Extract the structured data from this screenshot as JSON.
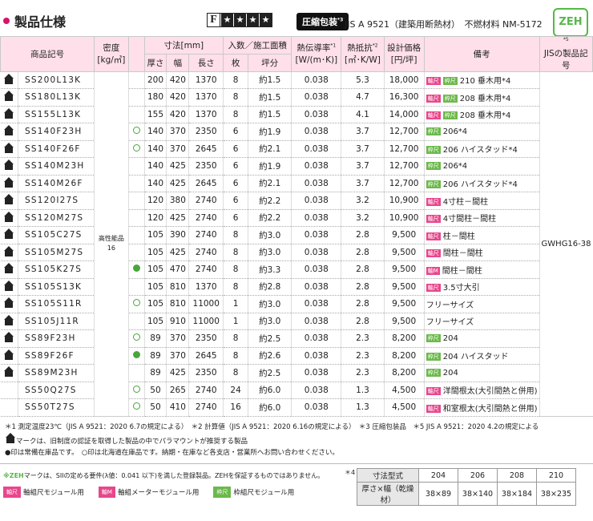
{
  "header": {
    "title": "製品仕様",
    "fire_rating": "F",
    "stars": [
      "★",
      "★",
      "★",
      "★"
    ],
    "compressed_label": "圧縮包装",
    "compressed_note": "*3",
    "jis_standard": "JIS A 9521（建築用断熱材）",
    "noncombustible": "不燃材料 NM-5172",
    "zeh_logo": "ZEH"
  },
  "table_headers": {
    "product_code": "商品記号",
    "density": "密度",
    "density_unit": "[kg/㎥]",
    "dimensions": "寸法",
    "dimensions_unit": "[mm]",
    "thickness": "厚さ",
    "width": "幅",
    "length": "長さ",
    "quantity": "入数／施工面積",
    "pieces": "枚",
    "tsubo": "坪分",
    "conductivity": "熱伝導率",
    "conductivity_note": "*1",
    "conductivity_unit": "[W/(m･K)]",
    "resistance": "熱抵抗",
    "resistance_note": "*2",
    "resistance_unit": "[㎡･K/W]",
    "price": "設計価格",
    "price_unit": "[円/坪]",
    "remarks": "備考",
    "jis_product": "JISの製品記号",
    "jis_note": "*5"
  },
  "density_value": "高性能品\n16",
  "jis_code": "GWHG16-38",
  "rows": [
    {
      "code": "SS200L13K",
      "mark": "",
      "t": "200",
      "w": "420",
      "l": "1370",
      "n": "8",
      "a": "約1.5",
      "k": "0.038",
      "r": "5.3",
      "p": "18,000",
      "tags": [
        "軸尺",
        "枠尺"
      ],
      "rem": "210 垂木用*4"
    },
    {
      "code": "SS180L13K",
      "mark": "",
      "t": "180",
      "w": "420",
      "l": "1370",
      "n": "8",
      "a": "約1.5",
      "k": "0.038",
      "r": "4.7",
      "p": "16,300",
      "tags": [
        "軸尺",
        "枠尺"
      ],
      "rem": "208 垂木用*4"
    },
    {
      "code": "SS155L13K",
      "mark": "",
      "t": "155",
      "w": "420",
      "l": "1370",
      "n": "8",
      "a": "約1.5",
      "k": "0.038",
      "r": "4.1",
      "p": "14,000",
      "tags": [
        "軸尺",
        "枠尺"
      ],
      "rem": "208 垂木用*4"
    },
    {
      "code": "SS140F23H",
      "mark": "ring",
      "t": "140",
      "w": "370",
      "l": "2350",
      "n": "6",
      "a": "約1.9",
      "k": "0.038",
      "r": "3.7",
      "p": "12,700",
      "tags": [
        "枠尺"
      ],
      "rem": "206*4"
    },
    {
      "code": "SS140F26F",
      "mark": "ring",
      "t": "140",
      "w": "370",
      "l": "2645",
      "n": "6",
      "a": "約2.1",
      "k": "0.038",
      "r": "3.7",
      "p": "12,700",
      "tags": [
        "枠尺"
      ],
      "rem": "206 ハイスタッド*4"
    },
    {
      "code": "SS140M23H",
      "mark": "",
      "t": "140",
      "w": "425",
      "l": "2350",
      "n": "6",
      "a": "約1.9",
      "k": "0.038",
      "r": "3.7",
      "p": "12,700",
      "tags": [
        "枠尺"
      ],
      "rem": "206*4"
    },
    {
      "code": "SS140M26F",
      "mark": "",
      "t": "140",
      "w": "425",
      "l": "2645",
      "n": "6",
      "a": "約2.1",
      "k": "0.038",
      "r": "3.7",
      "p": "12,700",
      "tags": [
        "枠尺"
      ],
      "rem": "206 ハイスタッド*4"
    },
    {
      "code": "SS120I27S",
      "mark": "",
      "t": "120",
      "w": "380",
      "l": "2740",
      "n": "6",
      "a": "約2.2",
      "k": "0.038",
      "r": "3.2",
      "p": "10,900",
      "tags": [
        "軸尺"
      ],
      "rem": "4寸柱－間柱"
    },
    {
      "code": "SS120M27S",
      "mark": "",
      "t": "120",
      "w": "425",
      "l": "2740",
      "n": "6",
      "a": "約2.2",
      "k": "0.038",
      "r": "3.2",
      "p": "10,900",
      "tags": [
        "軸尺"
      ],
      "rem": "4寸間柱－間柱"
    },
    {
      "code": "SS105C27S",
      "mark": "",
      "t": "105",
      "w": "390",
      "l": "2740",
      "n": "8",
      "a": "約3.0",
      "k": "0.038",
      "r": "2.8",
      "p": "9,500",
      "tags": [
        "軸尺"
      ],
      "rem": "柱－間柱"
    },
    {
      "code": "SS105M27S",
      "mark": "",
      "t": "105",
      "w": "425",
      "l": "2740",
      "n": "8",
      "a": "約3.0",
      "k": "0.038",
      "r": "2.8",
      "p": "9,500",
      "tags": [
        "軸尺"
      ],
      "rem": "間柱－間柱"
    },
    {
      "code": "SS105K27S",
      "mark": "fill",
      "t": "105",
      "w": "470",
      "l": "2740",
      "n": "8",
      "a": "約3.3",
      "k": "0.038",
      "r": "2.8",
      "p": "9,500",
      "tags": [
        "軸M"
      ],
      "rem": "間柱－間柱"
    },
    {
      "code": "SS105S13K",
      "mark": "",
      "t": "105",
      "w": "810",
      "l": "1370",
      "n": "8",
      "a": "約2.8",
      "k": "0.038",
      "r": "2.8",
      "p": "9,500",
      "tags": [
        "軸尺"
      ],
      "rem": "3.5寸大引"
    },
    {
      "code": "SS105S11R",
      "mark": "ring",
      "t": "105",
      "w": "810",
      "l": "11000",
      "n": "1",
      "a": "約3.0",
      "k": "0.038",
      "r": "2.8",
      "p": "9,500",
      "tags": [],
      "rem": "フリーサイズ"
    },
    {
      "code": "SS105J11R",
      "mark": "",
      "t": "105",
      "w": "910",
      "l": "11000",
      "n": "1",
      "a": "約3.0",
      "k": "0.038",
      "r": "2.8",
      "p": "9,500",
      "tags": [],
      "rem": "フリーサイズ"
    },
    {
      "code": "SS89F23H",
      "mark": "ring",
      "t": "89",
      "w": "370",
      "l": "2350",
      "n": "8",
      "a": "約2.5",
      "k": "0.038",
      "r": "2.3",
      "p": "8,200",
      "tags": [
        "枠尺"
      ],
      "rem": "204"
    },
    {
      "code": "SS89F26F",
      "mark": "fill",
      "t": "89",
      "w": "370",
      "l": "2645",
      "n": "8",
      "a": "約2.6",
      "k": "0.038",
      "r": "2.3",
      "p": "8,200",
      "tags": [
        "枠尺"
      ],
      "rem": "204 ハイスタッド"
    },
    {
      "code": "SS89M23H",
      "mark": "",
      "t": "89",
      "w": "425",
      "l": "2350",
      "n": "8",
      "a": "約2.5",
      "k": "0.038",
      "r": "2.3",
      "p": "8,200",
      "tags": [
        "枠尺"
      ],
      "rem": "204"
    },
    {
      "code": "SS50Q27S",
      "mark": "ring",
      "t": "50",
      "w": "265",
      "l": "2740",
      "n": "24",
      "a": "約6.0",
      "k": "0.038",
      "r": "1.3",
      "p": "4,500",
      "tags": [
        "軸尺"
      ],
      "rem": "洋間根太(大引間熱と併用)"
    },
    {
      "code": "SS50T27S",
      "mark": "ring",
      "t": "50",
      "w": "410",
      "l": "2740",
      "n": "16",
      "a": "約6.0",
      "k": "0.038",
      "r": "1.3",
      "p": "4,500",
      "tags": [
        "軸尺"
      ],
      "rem": "和室根太(大引間熱と併用)"
    }
  ],
  "icon_rows": [
    0,
    1,
    2,
    3,
    4,
    5,
    6,
    7,
    8,
    9,
    10,
    11,
    12,
    13,
    14,
    15,
    16,
    17
  ],
  "notes": [
    "＊1 測定温度23℃（JIS A 9521：2020 6.7の規定による）　＊2 計算値（JIS A 9521：2020 6.16の規定による）　＊3 圧縮包装品　＊5 JIS A 9521：2020 4.2の規定による",
    "マークは、旧制度の認証を取得した製品の中でパラマウントが推奨する製品",
    "●印は常備在庫品です。　○印は北海道在庫品です。納期・在庫など各支店・営業所へお問い合わせください。"
  ],
  "zeh_note_prefix": "※ZEH",
  "zeh_note": "マークは、SIIの定める要件(λ値：0.041 以下)を満した登録製品。ZEHを保証するものではありません。",
  "legend": [
    {
      "tag": "軸尺",
      "text": "軸組尺モジュール用"
    },
    {
      "tag": "軸M",
      "text": "軸組メーターモジュール用"
    },
    {
      "tag": "枠尺",
      "text": "枠組尺モジュール用"
    }
  ],
  "std_note": "＊4",
  "std_table": {
    "row1_label": "寸法型式",
    "row1": [
      "204",
      "206",
      "208",
      "210"
    ],
    "row2_label": "厚さ×幅（乾燥材）",
    "row2": [
      "38×89",
      "38×140",
      "38×184",
      "38×235"
    ]
  }
}
